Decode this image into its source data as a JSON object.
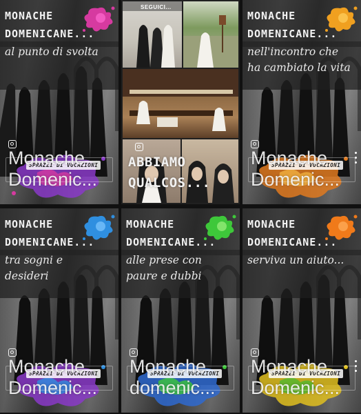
{
  "gallery": {
    "tiles": [
      {
        "title": "MONACHE DOMENICANE...",
        "subtitle": "al punto di svolta",
        "big_text": "Monache Domenic...",
        "badge": "SPRAZZI DI VOCAZIONI",
        "splat_color": "#d63aa0",
        "bottom_color": "#8a3ac8"
      },
      {
        "type": "collage",
        "seguici": "SEGUICI...",
        "big_text": "ABBIAMO QUALCOS..."
      },
      {
        "title": "MONACHE DOMENICANE...",
        "subtitle": "nell'incontro che ha cambiato la vita",
        "big_text": "Monache Domenic...",
        "badge": "SPRAZZI DI VOCAZIONI",
        "splat_color": "#f0a020",
        "bottom_color": "#e07a20"
      },
      {
        "title": "MONACHE DOMENICANE...",
        "subtitle": "tra sogni e desideri",
        "big_text": "Monache Domenic...",
        "badge": "SPRAZZI DI VOCAZIONI",
        "splat_color": "#2f8fe0",
        "bottom_color": "#8a3ac8"
      },
      {
        "title": "MONACHE DOMENICANE...",
        "subtitle": "alle prese con paure e dubbi",
        "big_text": "Monache domenic...",
        "badge": "SPRAZZI DI VOCAZIONI",
        "splat_color": "#3ec83a",
        "bottom_color": "#2f6ad0"
      },
      {
        "title": "MONACHE DOMENICANE...",
        "subtitle": "serviva un aiuto...",
        "big_text": "Monache Domenic...",
        "badge": "SPRAZZI DI VOCAZIONI",
        "splat_color": "#f07a1a",
        "bottom_color": "#e0c020"
      }
    ]
  },
  "icons": {
    "instagram": "instagram-icon",
    "more": "more-options-icon",
    "splat": "paint-splash-icon"
  }
}
